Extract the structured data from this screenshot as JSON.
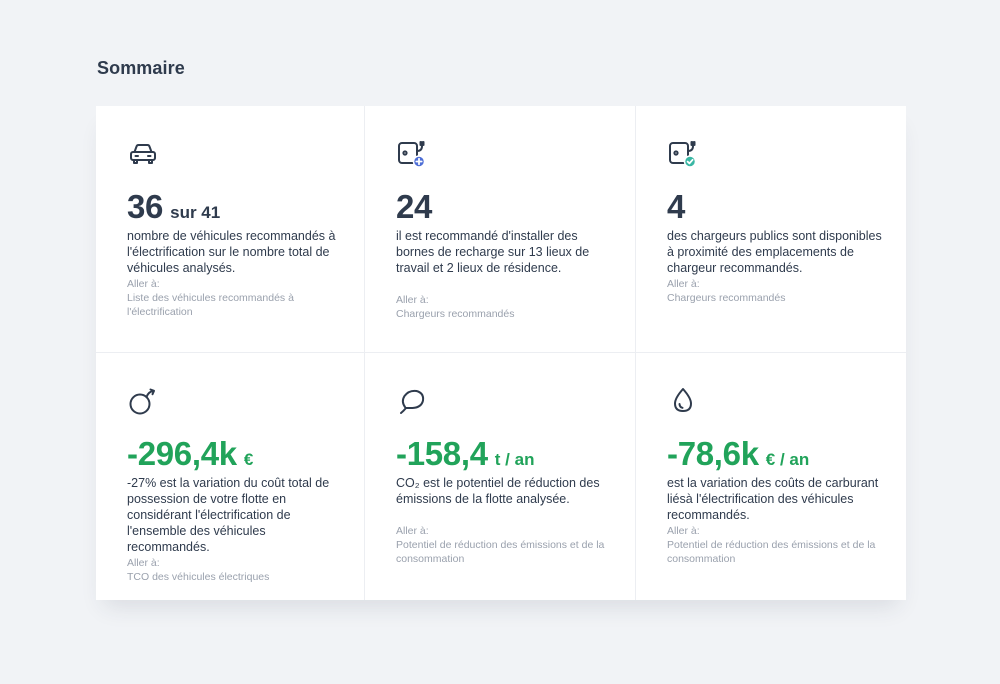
{
  "page": {
    "title": "Sommaire"
  },
  "colors": {
    "positive_green": "#21a35a",
    "text_dark": "#2f3b4d",
    "text_muted": "#9aa1ad",
    "badge_blue": "#4f6fd6",
    "badge_teal": "#3ab7a4"
  },
  "tiles": [
    {
      "icon": "car-icon",
      "value": "36",
      "unit": "sur 41",
      "description": "nombre de véhicules recommandés à l'électrification sur le nombre total de véhicules analysés.",
      "link_label": "Aller à:",
      "link_target": "Liste des véhicules recommandés à l'électrification"
    },
    {
      "icon": "charger-add-icon",
      "value": "24",
      "unit": "",
      "description": "il est recommandé d'installer des bornes de recharge sur 13 lieux de travail et 2 lieux de résidence.",
      "link_label": "Aller à:",
      "link_target": "Chargeurs recommandés"
    },
    {
      "icon": "charger-check-icon",
      "value": "4",
      "unit": "",
      "description": "des chargeurs publics sont disponibles à proximité des emplacements de chargeur recommandés.",
      "link_label": "Aller à:",
      "link_target": "Chargeurs recommandés"
    },
    {
      "icon": "coin-icon",
      "value": "-296,4k",
      "unit": "€",
      "description": "-27% est la variation du coût total de possession de votre flotte en considérant l'électrification de l'ensemble des véhicules recommandés.",
      "link_label": "Aller à:",
      "link_target": "TCO des véhicules électriques"
    },
    {
      "icon": "leaf-icon",
      "value": "-158,4",
      "unit": "t / an",
      "description": "CO₂ est le potentiel de réduction des émissions de la flotte analysée.",
      "link_label": "Aller à:",
      "link_target": "Potentiel de réduction des émissions et de la consommation"
    },
    {
      "icon": "fuel-drop-icon",
      "value": "-78,6k",
      "unit": "€ / an",
      "description": "est la variation des coûts de carburant liésà l'électrification des véhicules recommandés.",
      "link_label": "Aller à:",
      "link_target": "Potentiel de réduction des émissions et de la consommation"
    }
  ]
}
